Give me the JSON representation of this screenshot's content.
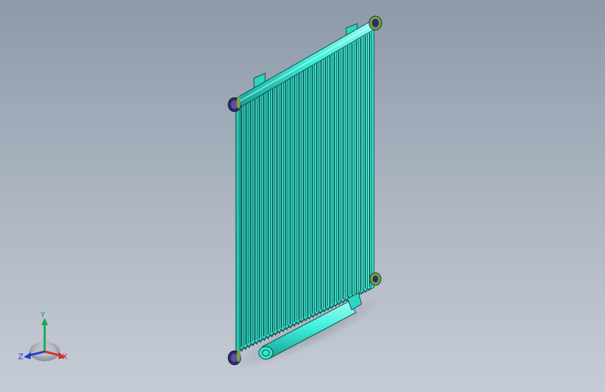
{
  "viewport": {
    "background_top": "#8e9aa9",
    "background_bottom": "#c6ccd6"
  },
  "model": {
    "fin_color": "#33dcc8",
    "fin_dark": "#0e3f3b",
    "tube_color": "#3ff0dc",
    "connector_color": "#2a2f6a",
    "connector_ring": "#7fb04a"
  },
  "triad": {
    "labels": {
      "y": "Y",
      "z": "Z",
      "x": "X"
    },
    "colors": {
      "y": "#1aa84a",
      "z": "#1f3fc8",
      "x": "#d0302a"
    },
    "icon": "view-orientation-triad-icon"
  }
}
